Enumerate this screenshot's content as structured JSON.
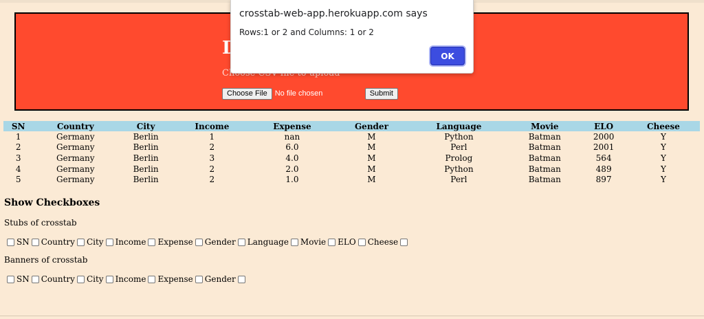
{
  "header": {
    "title": "D",
    "upload_label": "Choose CSV file to upload",
    "choose_file_label": "Choose File",
    "file_status": "No file chosen",
    "submit_label": "Submit"
  },
  "table": {
    "columns": [
      "SN",
      "Country",
      "City",
      "Income",
      "Expense",
      "Gender",
      "Language",
      "Movie",
      "ELO",
      "Cheese"
    ],
    "rows": [
      [
        "1",
        "Germany",
        "Berlin",
        "1",
        "nan",
        "M",
        "Python",
        "Batman",
        "2000",
        "Y"
      ],
      [
        "2",
        "Germany",
        "Berlin",
        "2",
        "6.0",
        "M",
        "Perl",
        "Batman",
        "2001",
        "Y"
      ],
      [
        "3",
        "Germany",
        "Berlin",
        "3",
        "4.0",
        "M",
        "Prolog",
        "Batman",
        "564",
        "Y"
      ],
      [
        "4",
        "Germany",
        "Berlin",
        "2",
        "2.0",
        "M",
        "Python",
        "Batman",
        "489",
        "Y"
      ],
      [
        "5",
        "Germany",
        "Berlin",
        "2",
        "1.0",
        "M",
        "Perl",
        "Batman",
        "897",
        "Y"
      ]
    ]
  },
  "checkboxes": {
    "section_title": "Show Checkboxes",
    "stubs_label": "Stubs of crosstab",
    "stubs": [
      "SN",
      "Country",
      "City",
      "Income",
      "Expense",
      "Gender",
      "Language",
      "Movie",
      "ELO",
      "Cheese"
    ],
    "banners_label": "Banners of crosstab",
    "banners": [
      "SN",
      "Country",
      "City",
      "Income",
      "Expense",
      "Gender"
    ]
  },
  "dialog": {
    "title": "crosstab-web-app.herokuapp.com says",
    "message": "Rows:1 or 2 and Columns: 1 or 2",
    "ok_label": "OK"
  }
}
